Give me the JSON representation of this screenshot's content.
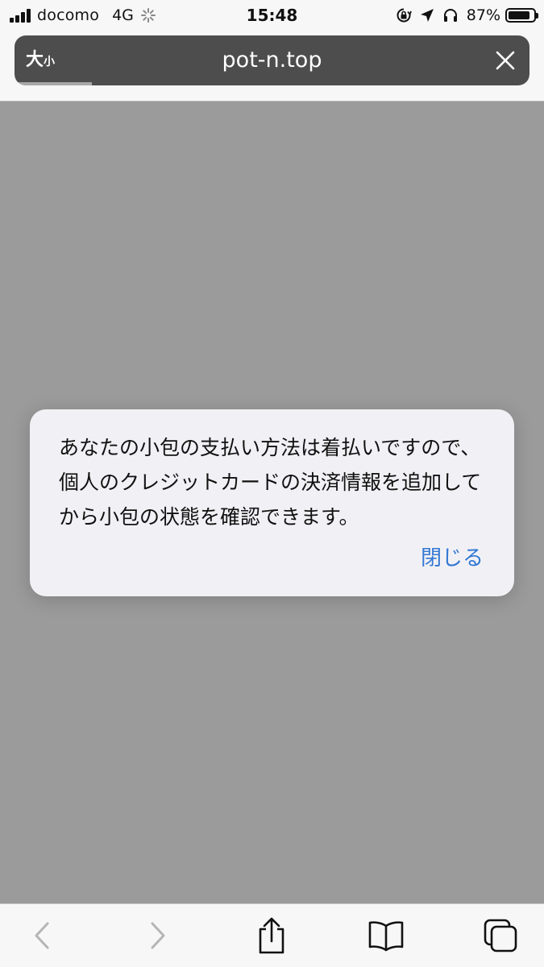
{
  "status_bar": {
    "carrier": "docomo",
    "network": "4G",
    "time": "15:48",
    "battery_percent": "87%",
    "battery_level": 0.87,
    "icons": [
      "signal-icon",
      "activity-spinner-icon",
      "orientation-lock-icon",
      "location-arrow-icon",
      "headphones-icon",
      "battery-icon"
    ]
  },
  "address_bar": {
    "text_size_big": "大",
    "text_size_small": "小",
    "url": "pot-n.top",
    "close_icon": "close-icon",
    "load_progress": 0.15
  },
  "alert": {
    "message": "あなたの小包の支払い方法は着払いですので、個人のクレジットカードの決済情報を追加してから小包の状態を確認できます。",
    "close_label": "閉じる",
    "accent_color": "#3478d3"
  },
  "bottom_toolbar": {
    "icons": [
      "back-chevron-icon",
      "forward-chevron-icon",
      "share-icon",
      "bookmarks-icon",
      "tabs-icon"
    ]
  },
  "colors": {
    "dimmed_background": "#9b9b9b",
    "url_pill": "#4d4d4d",
    "alert_background": "#f1f1f5"
  }
}
